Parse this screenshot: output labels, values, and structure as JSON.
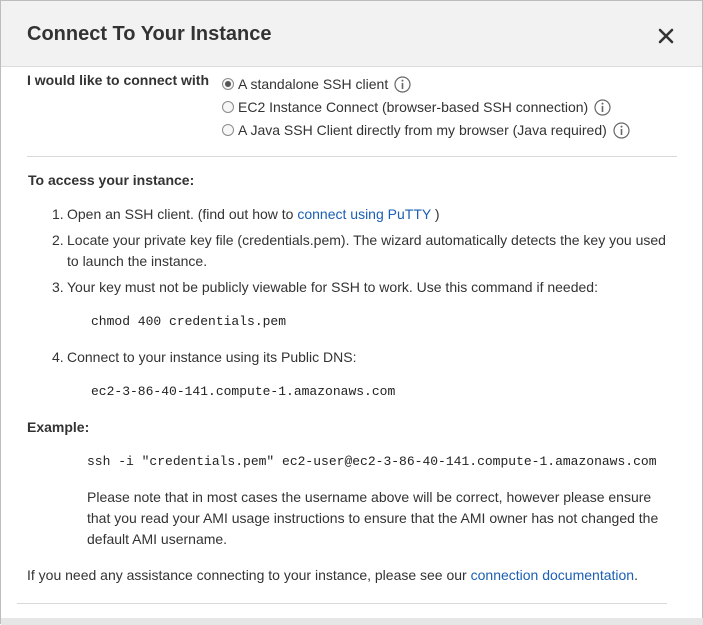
{
  "dialog": {
    "title": "Connect To Your Instance",
    "close_symbol": "close-icon"
  },
  "connect": {
    "label": "I would like to connect with",
    "options": [
      {
        "label": "A standalone SSH client",
        "selected": true,
        "icon": "info-icon"
      },
      {
        "label": "EC2 Instance Connect (browser-based SSH connection)",
        "selected": false,
        "icon": "info-icon"
      },
      {
        "label": "A Java SSH Client directly from my browser (Java required)",
        "selected": false,
        "icon": "info-icon"
      }
    ]
  },
  "access": {
    "title": "To access your instance:",
    "steps": [
      {
        "num": "1.",
        "text_before": "Open an SSH client. (find out how to",
        "link": "connect using PuTTY",
        "text_after": ")"
      },
      {
        "num": "2.",
        "text": "Locate your private key file (credentials.pem). The wizard automatically detects the key you used to launch the instance."
      },
      {
        "num": "3.",
        "text": "Your key must not be publicly viewable for SSH to work. Use this command if needed:"
      },
      {
        "num": "4.",
        "text": "Connect to your instance using its Public DNS:"
      }
    ],
    "chmod_command": "chmod 400 credentials.pem",
    "public_dns": "ec2-3-86-40-141.compute-1.amazonaws.com"
  },
  "example": {
    "title": "Example:",
    "command": "ssh -i \"credentials.pem\" ec2-user@ec2-3-86-40-141.compute-1.amazonaws.com",
    "note": "Please note that in most cases the username above will be correct, however please ensure that you read your AMI usage instructions to ensure that the AMI owner has not changed the default AMI username."
  },
  "assistance": {
    "text": "If you need any assistance connecting to your instance, please see our",
    "link": "connection documentation",
    "suffix": "."
  },
  "colors": {
    "link": "#1a5fb4",
    "header_bg": "#f2f2f2",
    "text": "#333333"
  }
}
